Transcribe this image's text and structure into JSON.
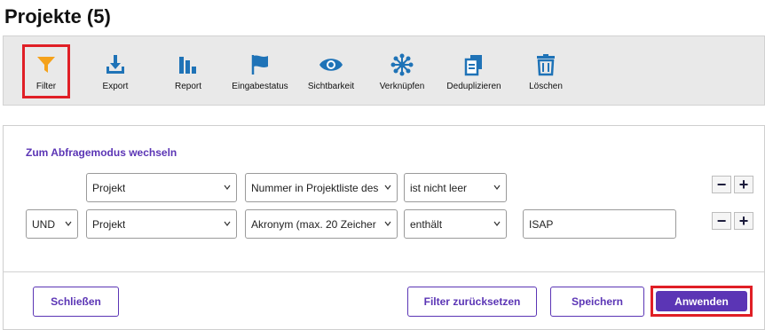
{
  "page": {
    "title": "Projekte (5)"
  },
  "toolbar": {
    "items": [
      {
        "label": "Filter",
        "icon": "filter-icon"
      },
      {
        "label": "Export",
        "icon": "download-icon"
      },
      {
        "label": "Report",
        "icon": "bar-chart-icon"
      },
      {
        "label": "Eingabestatus",
        "icon": "flag-icon"
      },
      {
        "label": "Sichtbarkeit",
        "icon": "eye-icon"
      },
      {
        "label": "Verknüpfen",
        "icon": "network-icon"
      },
      {
        "label": "Deduplizieren",
        "icon": "duplicate-icon"
      },
      {
        "label": "Löschen",
        "icon": "trash-icon"
      }
    ]
  },
  "filter_panel": {
    "mode_link": "Zum Abfragemodus wechseln",
    "rows": [
      {
        "connector": "",
        "entity": "Projekt",
        "field": "Nummer in Projektliste des",
        "operator": "ist nicht leer",
        "value": ""
      },
      {
        "connector": "UND",
        "entity": "Projekt",
        "field": "Akronym (max. 20 Zeicher",
        "operator": "enthält",
        "value": "ISAP"
      }
    ],
    "minus_label": "−",
    "plus_label": "+"
  },
  "buttons": {
    "close": "Schließen",
    "reset": "Filter zurücksetzen",
    "save": "Speichern",
    "apply": "Anwenden"
  },
  "colors": {
    "accent": "#5b35b5",
    "highlight": "#e01f26",
    "filter_icon": "#f5a21b",
    "icon_blue": "#1f73b7"
  }
}
